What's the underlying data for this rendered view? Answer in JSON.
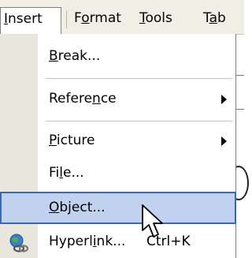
{
  "menubar": {
    "items": [
      {
        "label": "Insert",
        "underline": "I"
      },
      {
        "label": "Format",
        "underline": "o"
      },
      {
        "label": "Tools",
        "underline": "T"
      },
      {
        "label": "Tab",
        "underline": "a"
      }
    ],
    "active_index": 0
  },
  "insert_menu": {
    "items": [
      {
        "label": "Break...",
        "underline": "B",
        "has_submenu": false
      },
      {
        "label": "Reference",
        "underline": "n",
        "has_submenu": true
      },
      {
        "label": "Picture",
        "underline": "P",
        "has_submenu": true
      },
      {
        "label": "File...",
        "underline": "l",
        "has_submenu": false
      },
      {
        "label": "Object...",
        "underline": "O",
        "has_submenu": false,
        "highlighted": true
      },
      {
        "label": "Hyperlink...",
        "underline": "i",
        "has_submenu": false,
        "shortcut": "Ctrl+K",
        "icon": "hyperlink-globe-icon"
      }
    ]
  },
  "colors": {
    "highlight_fill": "#c1d2ee",
    "highlight_border": "#316ac5",
    "gutter": "#e9e6dd",
    "menubar": "#f1eee6"
  }
}
